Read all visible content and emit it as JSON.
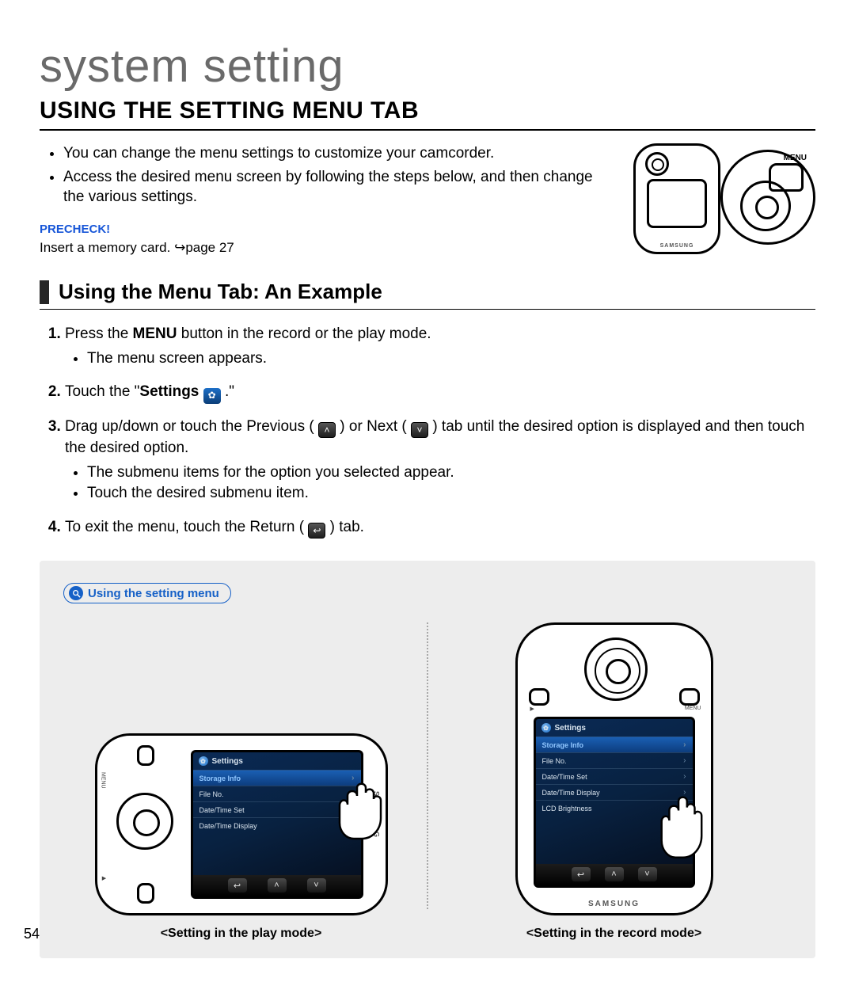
{
  "page": {
    "title": "system setting",
    "section": "USING THE SETTING MENU TAB",
    "page_number": "54"
  },
  "intro": {
    "bullets": [
      "You can change the menu settings to customize your camcorder.",
      "Access the desired menu screen by following the steps below, and then change the various settings."
    ]
  },
  "precheck": {
    "label": "PRECHECK!",
    "text_prefix": "Insert a memory card. ",
    "arrow": "↪",
    "page_ref": "page 27"
  },
  "top_device": {
    "menu_label": "MENU",
    "brand": "SAMSUNG"
  },
  "subheading": "Using the Menu Tab: An Example",
  "steps": {
    "s1_a": "Press the ",
    "s1_b": "MENU",
    "s1_c": " button in the record or the play mode.",
    "s1_sub": "The menu screen appears.",
    "s2_a": "Touch the \"",
    "s2_b": "Settings",
    "s2_c": " .\"",
    "s3_a": "Drag up/down or touch the Previous ( ",
    "s3_b": " ) or Next ( ",
    "s3_c": " ) tab until the desired option is displayed and then touch the desired option.",
    "s3_sub1": "The submenu items for the option you selected appear.",
    "s3_sub2": "Touch the desired submenu item.",
    "s4_a": "To exit the menu, touch the Return ( ",
    "s4_b": " ) tab."
  },
  "icons": {
    "gear": "✿",
    "up": "˄",
    "down": "˅",
    "return": "↩"
  },
  "gray": {
    "pill": "Using the setting menu",
    "cap_left": "<Setting in the play mode>",
    "cap_right": "<Setting in the record mode>",
    "brand": "SAMSUNG",
    "tiny_menu": "MENU",
    "tiny_play": "▶",
    "screen_h": {
      "title": "Settings",
      "items": [
        "Storage Info",
        "File No.",
        "Date/Time Set",
        "Date/Time Display"
      ]
    },
    "screen_v": {
      "title": "Settings",
      "items": [
        "Storage Info",
        "File No.",
        "Date/Time Set",
        "Date/Time Display",
        "LCD Brightness"
      ]
    },
    "nav": {
      "return": "↩",
      "up": "˄",
      "down": "˅"
    }
  }
}
